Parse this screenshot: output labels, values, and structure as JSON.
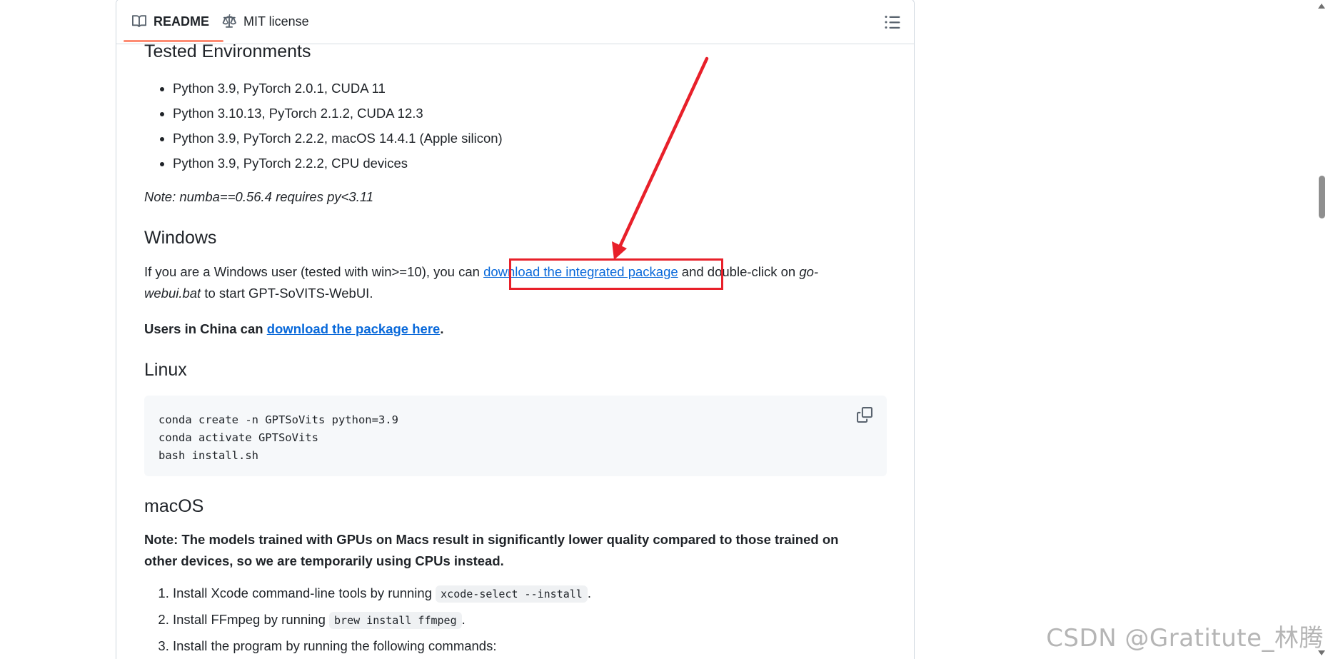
{
  "tabs": {
    "readme": "README",
    "license": "MIT license"
  },
  "tested": {
    "heading": "Tested Environments",
    "items": [
      "Python 3.9, PyTorch 2.0.1, CUDA 11",
      "Python 3.10.13, PyTorch 2.1.2, CUDA 12.3",
      "Python 3.9, PyTorch 2.2.2, macOS 14.4.1 (Apple silicon)",
      "Python 3.9, PyTorch 2.2.2, CPU devices"
    ],
    "note": "Note: numba==0.56.4 requires py<3.11"
  },
  "windows": {
    "heading": "Windows",
    "text_before": "If you are a Windows user (tested with win>=10), you can ",
    "link": "download the integrated package",
    "text_middle": " and double-click on ",
    "file_line1": "go-",
    "file_line2": "webui.bat",
    "text_after": " to start GPT-SoVITS-WebUI.",
    "china_text": "Users in China can ",
    "china_link": "download the package here",
    "china_end": "."
  },
  "linux": {
    "heading": "Linux",
    "code": [
      "conda create -n GPTSoVits python=3.9",
      "conda activate GPTSoVits",
      "bash install.sh"
    ]
  },
  "macos": {
    "heading": "macOS",
    "note_line1": "Note: The models trained with GPUs on Macs result in significantly lower quality compared to those trained on",
    "note_line2": "other devices, so we are temporarily using CPUs instead.",
    "steps": [
      {
        "text": "Install Xcode command-line tools by running ",
        "code": "xcode-select --install",
        "end": "."
      },
      {
        "text": "Install FFmpeg by running ",
        "code": "brew install ffmpeg",
        "end": "."
      },
      {
        "text": "Install the program by running the following commands:",
        "code": "",
        "end": ""
      }
    ]
  },
  "watermark": "CSDN @Gratitute_林腾",
  "colors": {
    "accent_link": "#0969da",
    "annotation_red": "#e8202a",
    "tab_underline": "#fd8c73"
  }
}
